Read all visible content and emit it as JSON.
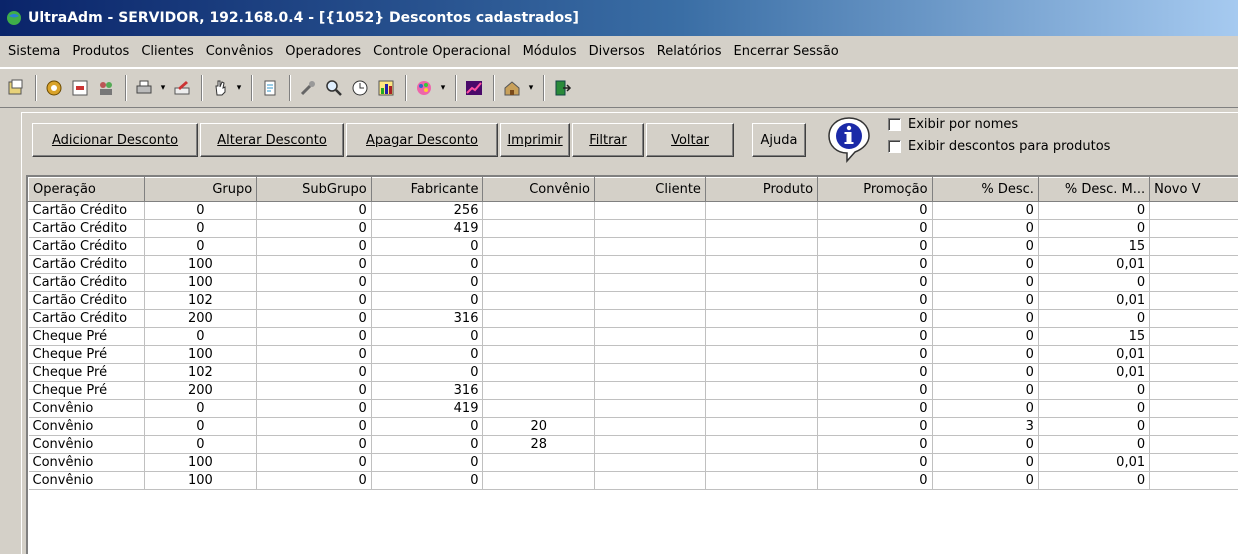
{
  "window": {
    "title": "UltraAdm - SERVIDOR, 192.168.0.4 - [{1052} Descontos cadastrados]"
  },
  "menu": [
    "Sistema",
    "Produtos",
    "Clientes",
    "Convênios",
    "Operadores",
    "Controle Operacional",
    "Módulos",
    "Diversos",
    "Relatórios",
    "Encerrar Sessão"
  ],
  "toolbar": {
    "icons": [
      "open-icon",
      "settings-icon",
      "report-icon",
      "users-icon",
      "print-icon",
      "edit-icon",
      "hand-icon",
      "document-icon",
      "tools-icon",
      "magnifier-icon",
      "clock-icon",
      "chart-icon",
      "palette-icon",
      "graph-icon",
      "building-icon",
      "exit-icon"
    ]
  },
  "actions": {
    "add": "Adicionar Desconto",
    "edit": "Alterar Desconto",
    "delete": "Apagar Desconto",
    "print": "Imprimir",
    "filter": "Filtrar",
    "back": "Voltar",
    "help": "Ajuda"
  },
  "options": {
    "by_names": "Exibir por nomes",
    "product_discounts": "Exibir descontos para produtos"
  },
  "table": {
    "columns": [
      "Operação",
      "Grupo",
      "SubGrupo",
      "Fabricante",
      "Convênio",
      "Cliente",
      "Produto",
      "Promoção",
      "% Desc.",
      "% Desc. M...",
      "Novo V"
    ],
    "rows": [
      [
        "Cartão Crédito",
        "0",
        "0",
        "256",
        "",
        "",
        "",
        "0",
        "0",
        "0",
        ""
      ],
      [
        "Cartão Crédito",
        "0",
        "0",
        "419",
        "",
        "",
        "",
        "0",
        "0",
        "0",
        ""
      ],
      [
        "Cartão Crédito",
        "0",
        "0",
        "0",
        "",
        "",
        "",
        "0",
        "0",
        "15",
        ""
      ],
      [
        "Cartão Crédito",
        "100",
        "0",
        "0",
        "",
        "",
        "",
        "0",
        "0",
        "0,01",
        ""
      ],
      [
        "Cartão Crédito",
        "100",
        "0",
        "0",
        "",
        "",
        "",
        "0",
        "0",
        "0",
        ""
      ],
      [
        "Cartão Crédito",
        "102",
        "0",
        "0",
        "",
        "",
        "",
        "0",
        "0",
        "0,01",
        ""
      ],
      [
        "Cartão Crédito",
        "200",
        "0",
        "316",
        "",
        "",
        "",
        "0",
        "0",
        "0",
        ""
      ],
      [
        "Cheque Pré",
        "0",
        "0",
        "0",
        "",
        "",
        "",
        "0",
        "0",
        "15",
        ""
      ],
      [
        "Cheque Pré",
        "100",
        "0",
        "0",
        "",
        "",
        "",
        "0",
        "0",
        "0,01",
        ""
      ],
      [
        "Cheque Pré",
        "102",
        "0",
        "0",
        "",
        "",
        "",
        "0",
        "0",
        "0,01",
        ""
      ],
      [
        "Cheque Pré",
        "200",
        "0",
        "316",
        "",
        "",
        "",
        "0",
        "0",
        "0",
        ""
      ],
      [
        "Convênio",
        "0",
        "0",
        "419",
        "",
        "",
        "",
        "0",
        "0",
        "0",
        ""
      ],
      [
        "Convênio",
        "0",
        "0",
        "0",
        "20",
        "",
        "",
        "0",
        "3",
        "0",
        ""
      ],
      [
        "Convênio",
        "0",
        "0",
        "0",
        "28",
        "",
        "",
        "0",
        "0",
        "0",
        ""
      ],
      [
        "Convênio",
        "100",
        "0",
        "0",
        "",
        "",
        "",
        "0",
        "0",
        "0,01",
        ""
      ],
      [
        "Convênio",
        "100",
        "0",
        "0",
        "",
        "",
        "",
        "0",
        "0",
        "0",
        ""
      ]
    ]
  }
}
